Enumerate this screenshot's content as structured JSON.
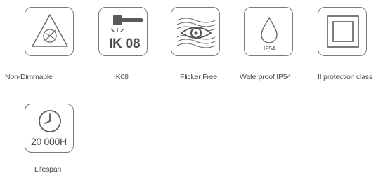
{
  "features": [
    {
      "id": "non_dimmable",
      "icon": "non-dimmable-icon",
      "caption": "Non-Dimmable"
    },
    {
      "id": "ik08",
      "icon": "hammer-impact-icon",
      "badge": "IK 08",
      "caption": "IK08"
    },
    {
      "id": "flicker_free",
      "icon": "flicker-free-eye-icon",
      "caption": "Flicker Free"
    },
    {
      "id": "waterproof",
      "icon": "water-drop-icon",
      "badge": "IP54",
      "caption": "Waterproof IP54"
    },
    {
      "id": "class2",
      "icon": "double-square-icon",
      "caption": "II protection class"
    },
    {
      "id": "lifespan",
      "icon": "clock-icon",
      "badge": "20 000H",
      "caption": "Lifespan"
    }
  ],
  "colors": {
    "stroke": "#7a7a7a",
    "text": "#4a4a4a",
    "background": "#ffffff"
  }
}
